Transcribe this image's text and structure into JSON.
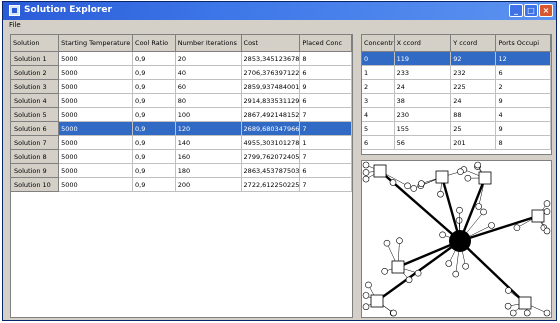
{
  "window": {
    "title": "Solution Explorer",
    "menu_file": "File"
  },
  "solutions_table": {
    "columns": [
      "Solution",
      "Starting Temperature",
      "Cool Ratio",
      "Number Iterations",
      "Cost",
      "Placed Conc"
    ],
    "rows": [
      {
        "name": "Solution 1",
        "temp": "5000",
        "ratio": "0,9",
        "iter": "20",
        "cost": "2853,345123678",
        "placed": "8"
      },
      {
        "name": "Solution 2",
        "temp": "5000",
        "ratio": "0,9",
        "iter": "40",
        "cost": "2706,376397122",
        "placed": "6"
      },
      {
        "name": "Solution 3",
        "temp": "5000",
        "ratio": "0,9",
        "iter": "60",
        "cost": "2859,937484001",
        "placed": "9"
      },
      {
        "name": "Solution 4",
        "temp": "5000",
        "ratio": "0,9",
        "iter": "80",
        "cost": "2914,833531129",
        "placed": "6"
      },
      {
        "name": "Solution 5",
        "temp": "5000",
        "ratio": "0,9",
        "iter": "100",
        "cost": "2867,492148152",
        "placed": "7"
      },
      {
        "name": "Solution 6",
        "temp": "5000",
        "ratio": "0,9",
        "iter": "120",
        "cost": "2689,680347966",
        "placed": "7"
      },
      {
        "name": "Solution 7",
        "temp": "5000",
        "ratio": "0,9",
        "iter": "140",
        "cost": "4955,303101278",
        "placed": "1"
      },
      {
        "name": "Solution 8",
        "temp": "5000",
        "ratio": "0,9",
        "iter": "160",
        "cost": "2799,762072405",
        "placed": "7"
      },
      {
        "name": "Solution 9",
        "temp": "5000",
        "ratio": "0,9",
        "iter": "180",
        "cost": "2863,453787503",
        "placed": "6"
      },
      {
        "name": "Solution 10",
        "temp": "5000",
        "ratio": "0,9",
        "iter": "200",
        "cost": "2722,612250225",
        "placed": "7"
      }
    ]
  },
  "concentrators_table": {
    "columns": [
      "Concentr",
      "X ccord",
      "Y ccord",
      "Ports Occupi"
    ],
    "rows": [
      {
        "id": "0",
        "x": "119",
        "y": "92",
        "ports": "12"
      },
      {
        "id": "1",
        "x": "233",
        "y": "232",
        "ports": "6"
      },
      {
        "id": "2",
        "x": "24",
        "y": "225",
        "ports": "2"
      },
      {
        "id": "3",
        "x": "38",
        "y": "24",
        "ports": "9"
      },
      {
        "id": "4",
        "x": "230",
        "y": "88",
        "ports": "4"
      },
      {
        "id": "5",
        "x": "155",
        "y": "25",
        "ports": "9"
      },
      {
        "id": "6",
        "x": "56",
        "y": "201",
        "ports": "8"
      }
    ]
  },
  "colors": {
    "title_bar": "#2a5bd7",
    "selection": "#316ac5",
    "frame": "#d4d0c8"
  }
}
